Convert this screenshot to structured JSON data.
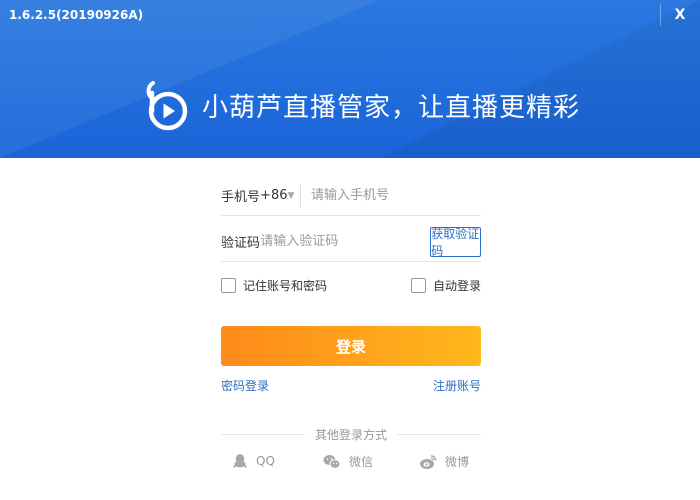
{
  "window": {
    "version": "1.6.2.5(20190926A)",
    "close_label": "X"
  },
  "banner": {
    "slogan": "小葫芦直播管家，让直播更精彩"
  },
  "form": {
    "phone_label": "手机号",
    "country_code": "+86",
    "phone_placeholder": "请输入手机号",
    "code_label": "验证码",
    "code_placeholder": "请输入验证码",
    "get_code_label": "获取验证码"
  },
  "options": {
    "remember_label": "记住账号和密码",
    "auto_login_label": "自动登录"
  },
  "login_label": "登录",
  "links": {
    "password_login": "密码登录",
    "register": "注册账号"
  },
  "other": {
    "title": "其他登录方式",
    "methods": [
      {
        "name": "QQ",
        "icon": "qq-icon"
      },
      {
        "name": "微信",
        "icon": "wechat-icon"
      },
      {
        "name": "微博",
        "icon": "weibo-icon"
      }
    ]
  },
  "colors": {
    "header": "#1a64d8",
    "accent": "#2d6ec8",
    "login_start": "#ff8a1a",
    "login_end": "#ffb81c"
  }
}
